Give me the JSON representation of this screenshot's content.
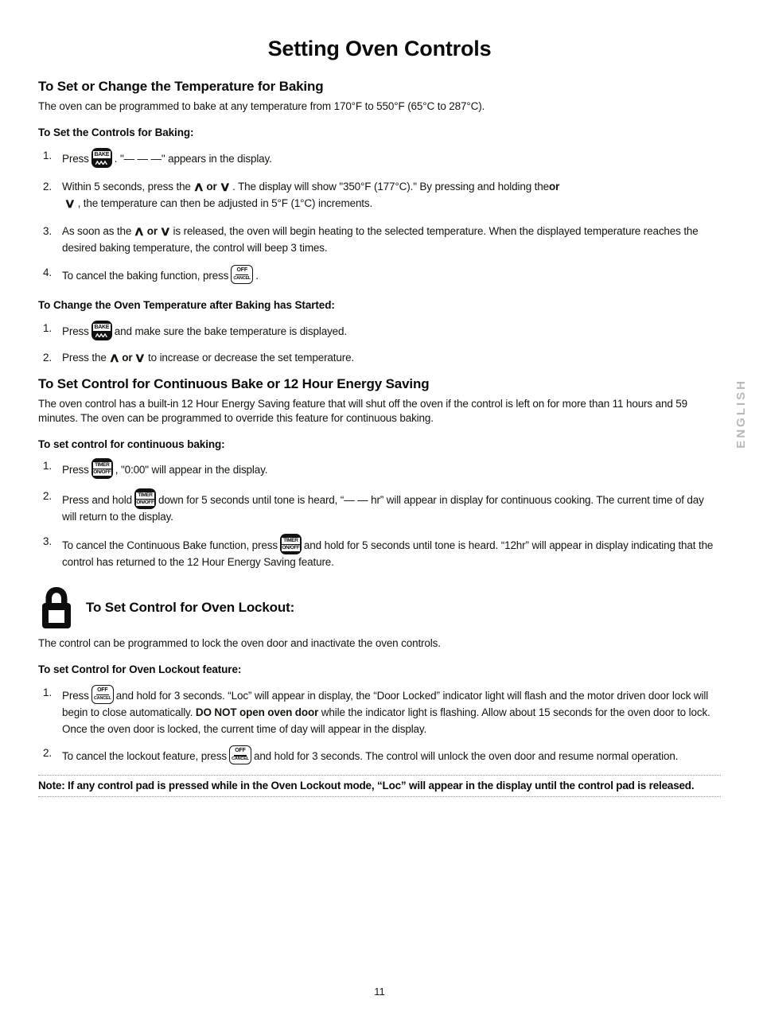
{
  "document": {
    "title": "Setting Oven Controls",
    "side_language_label": "ENGLISH",
    "page_number": "11"
  },
  "icons": {
    "bake": {
      "label": "BAKE",
      "name": "bake-button-icon"
    },
    "timer": {
      "line1": "TIMER",
      "line2": "ON/OFF",
      "name": "timer-on-off-button-icon"
    },
    "off_cancel": {
      "line1": "OFF",
      "line2": "CANCEL",
      "name": "off-cancel-button-icon"
    },
    "arrow_up": "∧",
    "arrow_down": "∨",
    "padlock": "padlock-icon"
  },
  "sections": [
    {
      "id": "temperature-for-baking",
      "heading": "To Set or Change the Temperature for Baking",
      "intro": "The oven can be programmed to bake at any temperature from 170°F to 550°F (65°C to 287°C).",
      "subheading": "To Set the Controls for Baking:",
      "steps": [
        {
          "num": "1.",
          "parts": [
            {
              "t": "text",
              "v": "Press "
            },
            {
              "t": "icon",
              "v": "bake"
            },
            {
              "t": "text",
              "v": " . \"— — —\" appears in the display."
            }
          ],
          "plain": "Press [BAKE] . \"— — —\" appears in the display."
        },
        {
          "num": "2.",
          "plain": "Within 5 seconds, press the ∧ or ∨ . The display will show \"350°F (177°C).\" By pressing and holding the ∧ or ∨ , the temperature can then be adjusted in 5°F (1°C) increments.",
          "frag": {
            "a": "Within 5 seconds, press the",
            "or": "or",
            "b": ". The display will show \"350°F (177°C).\" By pressing and holding the",
            "c": ", the temperature can then be adjusted in 5°F (1°C) increments."
          }
        },
        {
          "num": "3.",
          "plain": "As soon as the ∧ or ∨ is released, the oven will begin heating to the selected temperature. When the displayed temperature reaches the desired baking temperature, the control will beep 3 times.",
          "frag": {
            "a": "As soon as the",
            "or": "or",
            "b": "is released, the oven will begin heating to the selected temperature. When the displayed temperature reaches the desired baking temperature, the control will beep 3 times."
          }
        },
        {
          "num": "4.",
          "plain": "To cancel the baking function, press [OFF/CANCEL] .",
          "frag": {
            "a": "To cancel the baking function, press",
            "b": "."
          }
        }
      ]
    },
    {
      "id": "change-temperature-after-baking",
      "subheading": "To Change the Oven Temperature after Baking has Started:",
      "steps": [
        {
          "num": "1.",
          "plain": "Press [BAKE] and make sure the bake temperature is displayed.",
          "frag": {
            "a": "Press",
            "b": "and make sure the bake temperature is displayed."
          }
        },
        {
          "num": "2.",
          "plain": "Press the ∧ or ∨ to increase or decrease the set temperature.",
          "frag": {
            "a": "Press the",
            "or": "or",
            "b": "to increase or decrease the set temperature."
          }
        }
      ]
    },
    {
      "id": "continuous-bake",
      "heading": "To Set Control for Continuous Bake or 12 Hour Energy Saving",
      "intro": "The oven control has a built-in 12 Hour Energy Saving feature that will shut off the oven if the control is left on for more than 11 hours and 59 minutes. The oven can be programmed to override this feature for continuous baking.",
      "subheading": "To set control for continuous baking:",
      "steps": [
        {
          "num": "1.",
          "plain": "Press [TIMER ON/OFF] , \"0:00\" will appear in the display.",
          "frag": {
            "a": "Press",
            "b": ", \"0:00\" will appear in the display."
          }
        },
        {
          "num": "2.",
          "plain": "Press and hold [TIMER ON/OFF] down for 5 seconds until tone is heard, “— — hr” will appear in display for continuous cooking. The current time of day will return to the display.",
          "frag": {
            "a": "Press and hold",
            "b": "down for 5 seconds until tone is heard, “— —  hr” will appear in display for continuous cooking. The current time of day will return to the display."
          }
        },
        {
          "num": "3.",
          "plain": "To cancel the Continuous Bake function, press [TIMER ON/OFF] and hold for 5 seconds until tone is heard. “12hr” will appear in display indicating that the control has returned to the 12 Hour Energy Saving feature.",
          "frag": {
            "a": "To cancel the Continuous Bake function, press",
            "b": "and hold for 5 seconds until tone is heard. “12hr” will appear in display indicating that the control has returned to the 12 Hour Energy Saving feature."
          }
        }
      ]
    },
    {
      "id": "oven-lockout",
      "heading": "To Set Control for Oven Lockout:",
      "intro": "The control can be programmed to lock the oven door and inactivate the oven controls.",
      "subheading": "To set Control for Oven Lockout feature:",
      "steps": [
        {
          "num": "1.",
          "plain": "Press [OFF/CANCEL] and hold for 3 seconds. “Loc” will appear in display, the “Door Locked” indicator light will flash and the motor driven door lock will begin to close automatically. DO NOT open oven door while the indicator light is flashing. Allow about 15 seconds for the oven door to lock. Once the oven door is locked, the current time of day will appear in the display.",
          "frag": {
            "a": "Press",
            "b": "and hold for 3 seconds. “Loc” will appear in display, the “Door Locked” indicator light will flash and the motor driven door lock will begin to close automatically. ",
            "bold": "DO NOT open oven door",
            "c": " while the indicator light is flashing. Allow about 15 seconds for the oven door to lock. Once the oven door is locked, the current time of day will appear in the display."
          }
        },
        {
          "num": "2.",
          "plain": "To cancel the lockout feature, press [OFF/CANCEL] and hold for 3 seconds. The control will unlock the oven door and resume normal operation.",
          "frag": {
            "a": "To cancel the lockout feature, press",
            "b": "and hold for 3 seconds. The control will unlock the oven door and resume normal operation."
          }
        }
      ]
    }
  ],
  "note": {
    "text": "Note: If any control pad is pressed while in the Oven Lockout mode, “Loc” will appear in the display until the control pad is released."
  }
}
